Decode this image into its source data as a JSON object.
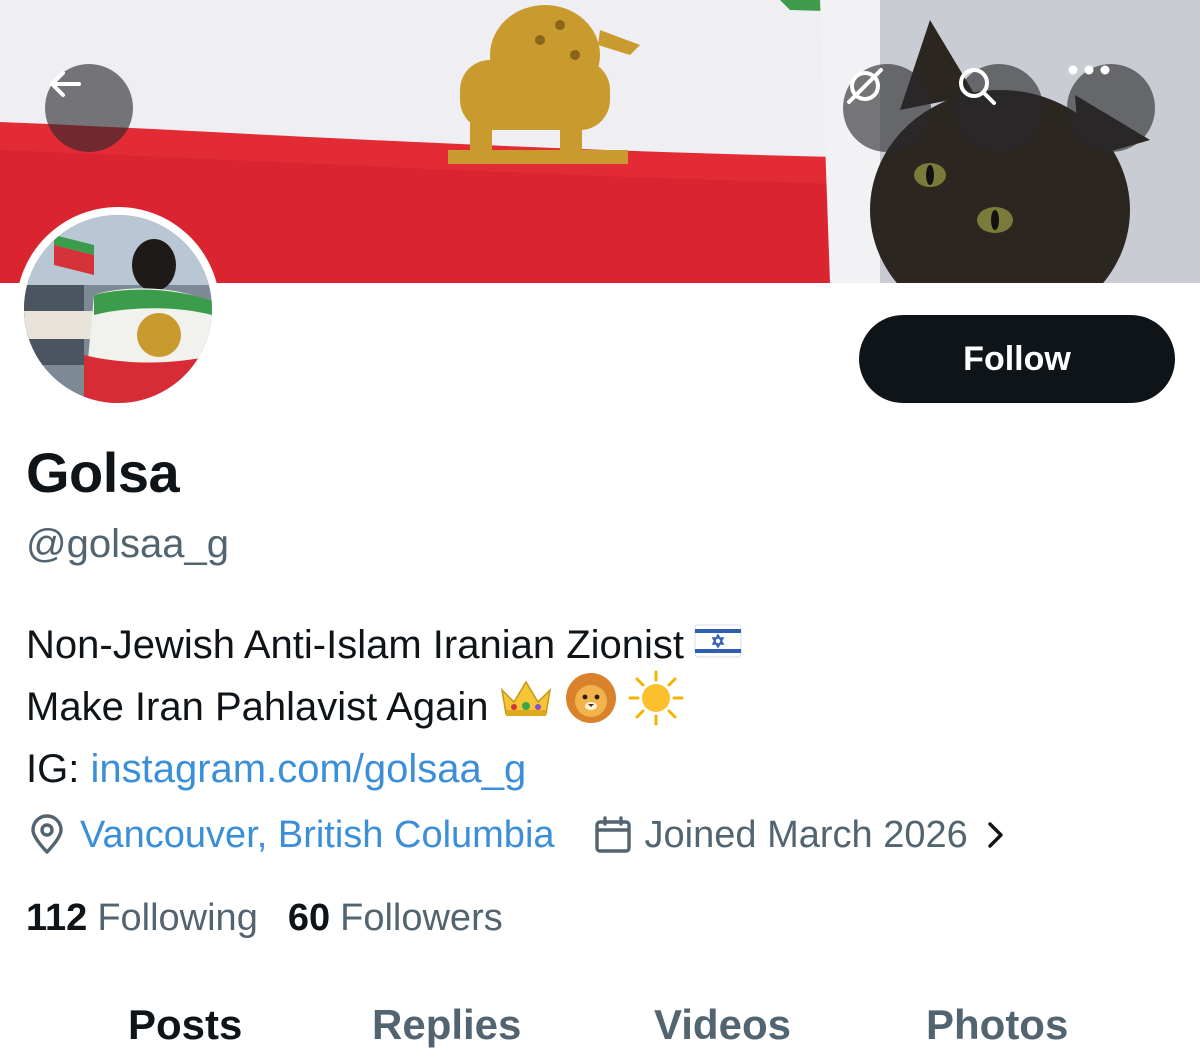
{
  "header": {
    "back_icon": "arrow-left-icon",
    "grok_icon": "grok-icon",
    "search_icon": "search-icon",
    "more_icon": "more-horizontal-icon"
  },
  "profile": {
    "display_name": "Golsa",
    "handle": "@golsaa_g",
    "follow_label": "Follow",
    "bio": {
      "line1_text": "Non-Jewish Anti-Islam Iranian Zionist",
      "line1_emoji": "🇮🇱",
      "line2_text": "Make Iran Pahlavist Again",
      "line2_emojis": [
        "👑",
        "🦁",
        "☀️"
      ],
      "line3_prefix": "IG: ",
      "line3_link": "instagram.com/golsaa_g"
    },
    "location": "Vancouver, British Columbia",
    "joined": "Joined March 2026",
    "following_count": "112",
    "following_label": "Following",
    "followers_count": "60",
    "followers_label": "Followers"
  },
  "tabs": [
    {
      "label": "Posts",
      "active": true
    },
    {
      "label": "Replies",
      "active": false
    },
    {
      "label": "Videos",
      "active": false
    },
    {
      "label": "Photos",
      "active": false
    }
  ],
  "colors": {
    "text_primary": "#0f1419",
    "text_secondary": "#536471",
    "link": "#3b8fd9",
    "follow_button_bg": "#0f1419"
  }
}
